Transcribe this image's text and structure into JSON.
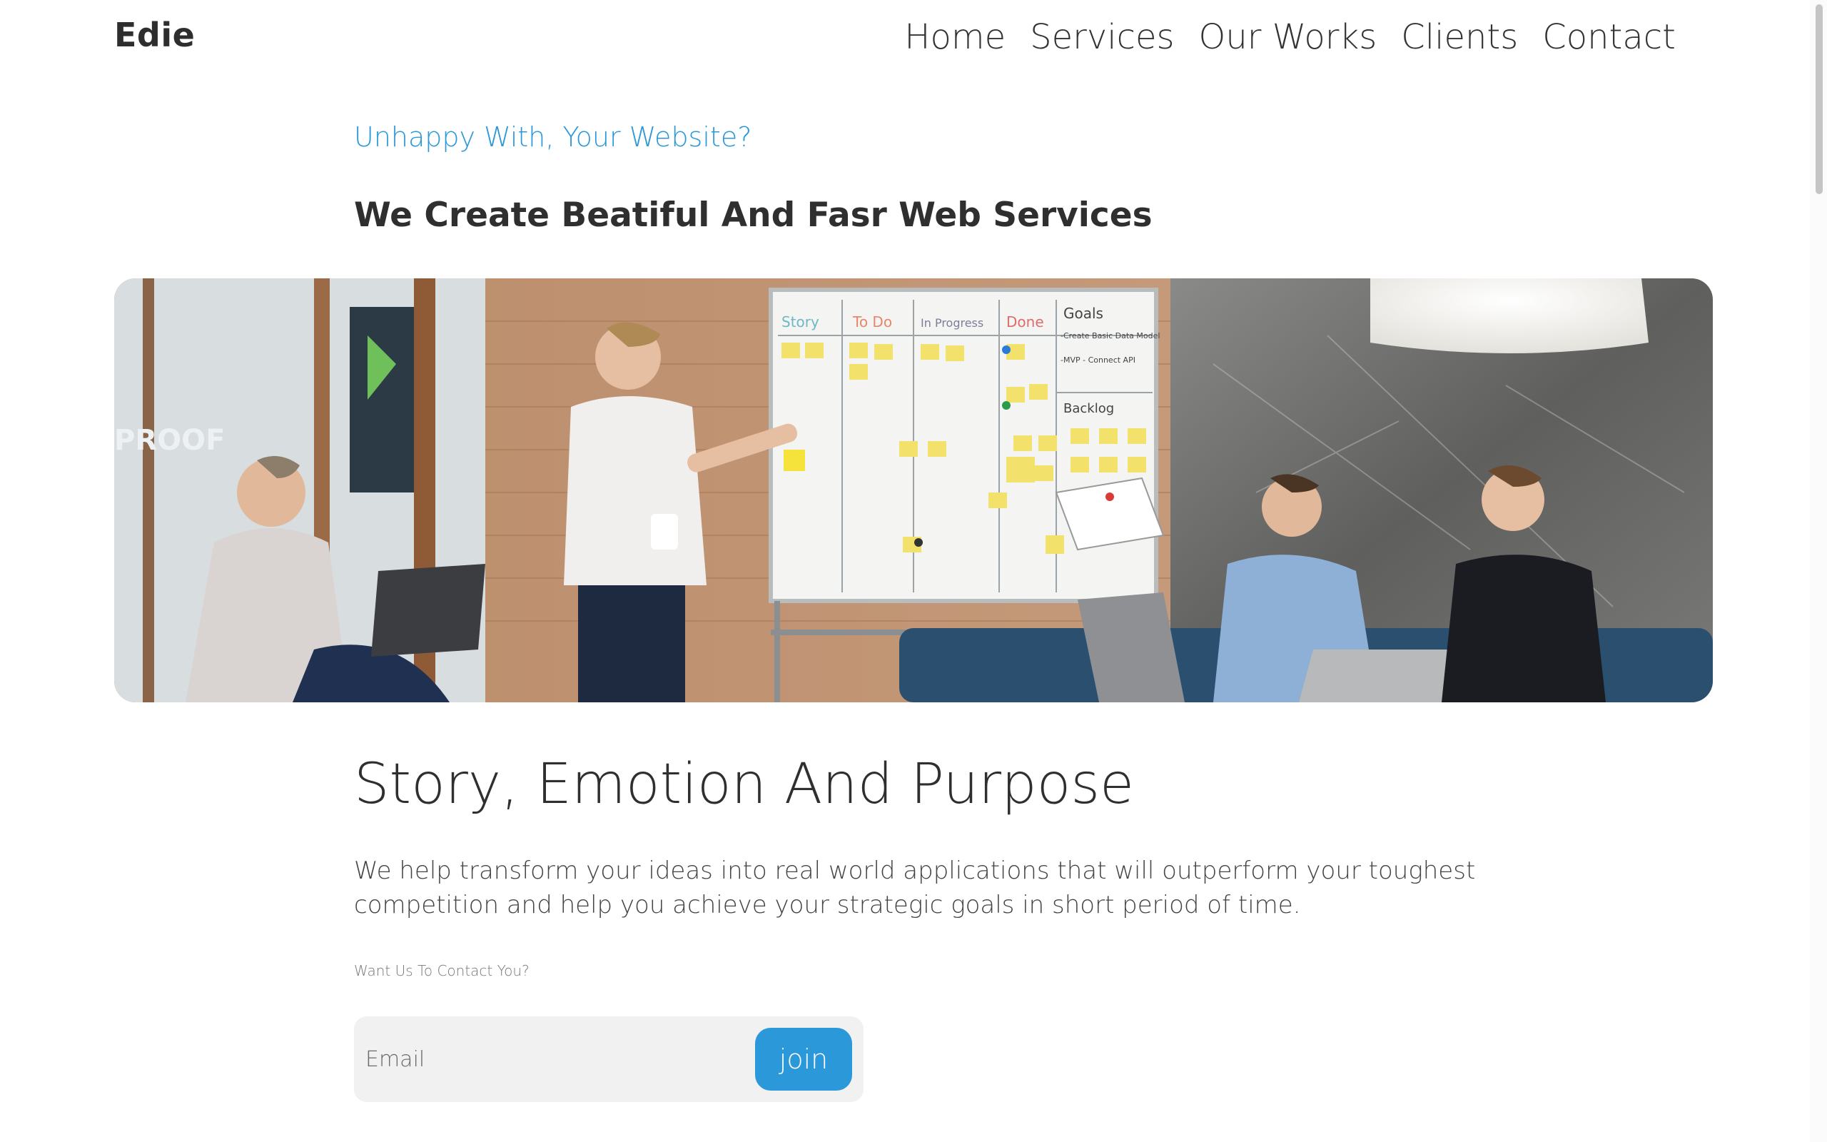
{
  "header": {
    "logo": "Edie",
    "nav": [
      {
        "label": "Home"
      },
      {
        "label": "Services"
      },
      {
        "label": "Our Works"
      },
      {
        "label": "Clients"
      },
      {
        "label": "Contact"
      }
    ]
  },
  "hero": {
    "eyebrow": "Unhappy With, Your Website?",
    "headline": "We Create Beatiful And Fasr Web Services",
    "image": {
      "whiteboard_columns": [
        "Story",
        "To Do",
        "In Progress",
        "Done"
      ],
      "whiteboard_goals": [
        "Goals",
        "-Create Basic Data Model",
        "-MVP - Connect API",
        "Backlog"
      ],
      "wall_sign": "PROOF"
    }
  },
  "story": {
    "title": "Story, Emotion And Purpose",
    "body": "We help transform your ideas into real world applications that will outperform your toughest competition and help you achieve your strategic goals in short period of time.",
    "contact_label": "Want Us To Contact You?"
  },
  "form": {
    "email_placeholder": "Email",
    "join_label": "join"
  },
  "colors": {
    "accent": "#2b98d9",
    "text_dark": "#2f2f2f",
    "form_bg": "#f1f1f1"
  }
}
